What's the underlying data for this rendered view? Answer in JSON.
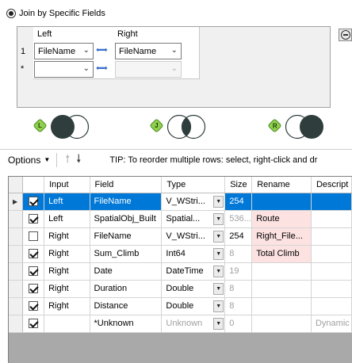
{
  "join_option": {
    "label": "Join by Specific Fields"
  },
  "join_fields": {
    "left_header": "Left",
    "right_header": "Right",
    "rows": [
      {
        "num": "1",
        "left": "FileName",
        "right": "FileName",
        "right_disabled": false
      },
      {
        "num": "*",
        "left": "",
        "right": "",
        "right_disabled": true
      }
    ]
  },
  "venn_outputs": [
    {
      "anchor": "L",
      "icon": "left-join-venn-icon"
    },
    {
      "anchor": "J",
      "icon": "inner-join-venn-icon"
    },
    {
      "anchor": "R",
      "icon": "right-join-venn-icon"
    }
  ],
  "toolbar": {
    "options_label": "Options",
    "tip": "TIP: To reorder multiple rows: select, right-click and dr"
  },
  "grid": {
    "columns": [
      "Input",
      "Field",
      "Type",
      "Size",
      "Rename",
      "Descript"
    ],
    "rows": [
      {
        "checked": true,
        "input": "Left",
        "field": "FileName",
        "type": "V_WStri...",
        "size": "254",
        "rename": "",
        "desc": "",
        "selected": true,
        "size_muted": false,
        "type_muted": false,
        "rename_hl": false
      },
      {
        "checked": true,
        "input": "Left",
        "field": "SpatialObj_Built",
        "type": "Spatial...",
        "size": "536...",
        "rename": "Route",
        "desc": "",
        "selected": false,
        "size_muted": true,
        "type_muted": false,
        "rename_hl": true
      },
      {
        "checked": false,
        "input": "Right",
        "field": "FileName",
        "type": "V_WStri...",
        "size": "254",
        "rename": "Right_File...",
        "desc": "",
        "selected": false,
        "size_muted": false,
        "type_muted": false,
        "rename_hl": true
      },
      {
        "checked": true,
        "input": "Right",
        "field": "Sum_Climb",
        "type": "Int64",
        "size": "8",
        "rename": "Total Climb",
        "desc": "",
        "selected": false,
        "size_muted": true,
        "type_muted": false,
        "rename_hl": true
      },
      {
        "checked": true,
        "input": "Right",
        "field": "Date",
        "type": "DateTime",
        "size": "19",
        "rename": "",
        "desc": "",
        "selected": false,
        "size_muted": true,
        "type_muted": false,
        "rename_hl": false
      },
      {
        "checked": true,
        "input": "Right",
        "field": "Duration",
        "type": "Double",
        "size": "8",
        "rename": "",
        "desc": "",
        "selected": false,
        "size_muted": true,
        "type_muted": false,
        "rename_hl": false
      },
      {
        "checked": true,
        "input": "Right",
        "field": "Distance",
        "type": "Double",
        "size": "8",
        "rename": "",
        "desc": "",
        "selected": false,
        "size_muted": true,
        "type_muted": false,
        "rename_hl": false
      },
      {
        "checked": true,
        "input": "",
        "field": "*Unknown",
        "type": "Unknown",
        "size": "0",
        "rename": "",
        "desc": "Dynamic",
        "selected": false,
        "size_muted": true,
        "type_muted": true,
        "rename_hl": false
      }
    ]
  },
  "colors": {
    "selection": "#0078d7",
    "rename_highlight": "#fde2e2",
    "anchor_badge": "#8fd14f",
    "venn_fill": "#2f3d3d"
  }
}
